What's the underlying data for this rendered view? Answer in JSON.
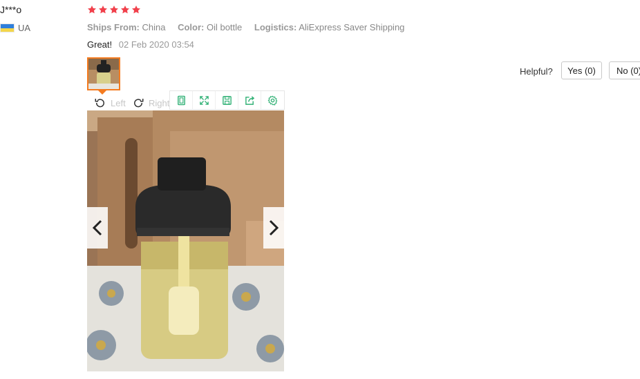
{
  "user": {
    "name": "J***o",
    "country": "UA",
    "flag_colors": [
      "#2f7fdc",
      "#f4d64a"
    ]
  },
  "rating": {
    "stars": 5,
    "max": 5,
    "color": "#f1404b"
  },
  "meta": {
    "ships_from_label": "Ships From:",
    "ships_from_value": "China",
    "color_label": "Color:",
    "color_value": "Oil bottle",
    "logistics_label": "Logistics:",
    "logistics_value": "AliExpress Saver Shipping"
  },
  "review": {
    "text": "Great!",
    "date": "02 Feb 2020 03:54"
  },
  "image_viewer": {
    "rotate_left_label": "Left",
    "rotate_right_label": "Right",
    "toolbar_icons": [
      "fit-screen-icon",
      "fullscreen-icon",
      "save-icon",
      "share-icon",
      "settings-icon"
    ],
    "toolbar_icon_color": "#2fb074",
    "thumbnail_selected_color": "#f47b20"
  },
  "helpful": {
    "label": "Helpful?",
    "yes_label": "Yes (0)",
    "no_label": "No (0)"
  }
}
